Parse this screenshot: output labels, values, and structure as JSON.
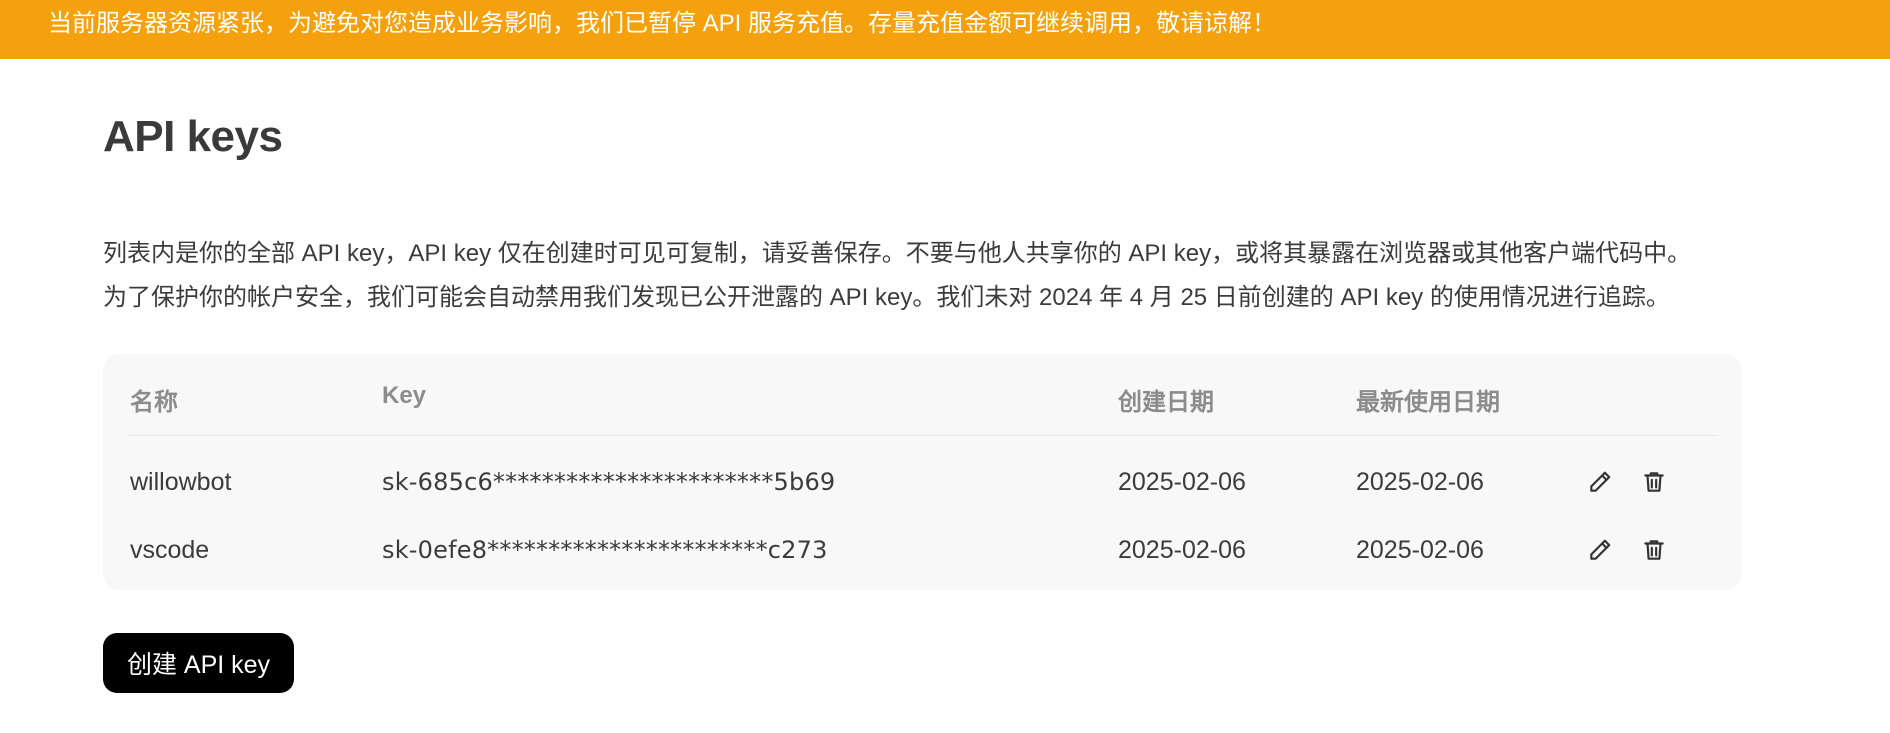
{
  "banner": {
    "text": "当前服务器资源紧张，为避免对您造成业务影响，我们已暂停 API 服务充值。存量充值金额可继续调用，敬请谅解！"
  },
  "page": {
    "title": "API keys",
    "description_line1": "列表内是你的全部 API key，API key 仅在创建时可见可复制，请妥善保存。不要与他人共享你的 API key，或将其暴露在浏览器或其他客户端代码中。",
    "description_line2": "为了保护你的帐户安全，我们可能会自动禁用我们发现已公开泄露的 API key。我们未对 2024 年 4 月 25 日前创建的 API key 的使用情况进行追踪。"
  },
  "table": {
    "headers": {
      "name": "名称",
      "key": "Key",
      "created": "创建日期",
      "last_used": "最新使用日期"
    },
    "rows": [
      {
        "name": "willowbot",
        "key": "sk-685c6***********************5b69",
        "created": "2025-02-06",
        "last_used": "2025-02-06",
        "edit_icon": "pencil-icon",
        "delete_icon": "trash-icon"
      },
      {
        "name": "vscode",
        "key": "sk-0efe8***********************c273",
        "created": "2025-02-06",
        "last_used": "2025-02-06",
        "edit_icon": "pencil-icon",
        "delete_icon": "trash-icon"
      }
    ]
  },
  "actions": {
    "create_label": "创建 API key"
  },
  "colors": {
    "banner_bg": "#f5a00d",
    "table_bg": "#f8f8f8",
    "primary_button_bg": "#000000"
  }
}
